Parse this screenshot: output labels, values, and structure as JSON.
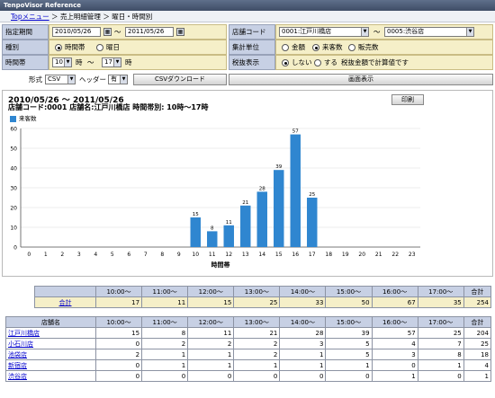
{
  "app": {
    "title": "TenpoVisor Reference"
  },
  "breadcrumb": {
    "top": "Topメニュー",
    "sep": " ＞ ",
    "level1": "売上明細管理",
    "level2": "曜日・時間別"
  },
  "form": {
    "period_label": "指定期間",
    "date_from": "2010/05/26",
    "range_sep": "〜",
    "date_to": "2011/05/26",
    "shop_label": "店舗コード",
    "shop_from": "0001:江戸川橋店",
    "shop_to": "0005:渋谷店",
    "type_label": "種別",
    "type_opt1": "時間帯",
    "type_opt2": "曜日",
    "unit_label": "集計単位",
    "unit_opt1": "金額",
    "unit_opt2": "来客数",
    "unit_opt3": "販売数",
    "hour_label": "時間帯",
    "hour_from": "10",
    "hour_unit": "時",
    "hour_to": "17",
    "tax_label": "税抜表示",
    "tax_opt1": "しない",
    "tax_opt2": "する",
    "tax_note": "税抜金額で計算値です",
    "format_label": "形式",
    "format_value": "CSV",
    "header_label": "ヘッダー",
    "header_value": "有",
    "csv_button": "CSVダウンロード",
    "display_button": "画面表示"
  },
  "chart": {
    "range_title": "2010/05/26 〜 2011/05/26",
    "shop_title": "店舗コード:0001  店舗名:江戸川橋店  時間帯別: 10時〜17時",
    "print_button": "印刷",
    "legend": "来客数",
    "xlabel": "時間帯"
  },
  "chart_data": {
    "type": "bar",
    "categories": [
      "0",
      "1",
      "2",
      "3",
      "4",
      "5",
      "6",
      "7",
      "8",
      "9",
      "10",
      "11",
      "12",
      "13",
      "14",
      "15",
      "16",
      "17",
      "18",
      "19",
      "20",
      "21",
      "22",
      "23"
    ],
    "series": [
      {
        "name": "来客数",
        "values": [
          0,
          0,
          0,
          0,
          0,
          0,
          0,
          0,
          0,
          0,
          15,
          8,
          11,
          21,
          28,
          39,
          57,
          25,
          0,
          0,
          0,
          0,
          0,
          0
        ]
      }
    ],
    "xlabel": "時間帯",
    "ylabel": "",
    "ylim": [
      0,
      60
    ],
    "yticks": [
      0,
      10,
      20,
      30,
      40,
      50,
      60
    ],
    "grid": true,
    "legend_position": "top-left",
    "color": "#2f86d0"
  },
  "summary_table": {
    "headers": [
      "",
      "10:00〜",
      "11:00〜",
      "12:00〜",
      "13:00〜",
      "14:00〜",
      "15:00〜",
      "16:00〜",
      "17:00〜",
      "合計"
    ],
    "row_label": "合計",
    "values": [
      "17",
      "11",
      "15",
      "25",
      "33",
      "50",
      "67",
      "35",
      "254"
    ]
  },
  "detail_table": {
    "headers": [
      "店舗名",
      "10:00〜",
      "11:00〜",
      "12:00〜",
      "13:00〜",
      "14:00〜",
      "15:00〜",
      "16:00〜",
      "17:00〜",
      "合計"
    ],
    "rows": [
      {
        "name": "江戸川橋店",
        "values": [
          "15",
          "8",
          "11",
          "21",
          "28",
          "39",
          "57",
          "25",
          "204"
        ]
      },
      {
        "name": "小石川店",
        "values": [
          "0",
          "2",
          "2",
          "2",
          "3",
          "5",
          "4",
          "7",
          "25"
        ]
      },
      {
        "name": "池袋店",
        "values": [
          "2",
          "1",
          "1",
          "2",
          "1",
          "5",
          "3",
          "8",
          "18"
        ]
      },
      {
        "name": "新宿店",
        "values": [
          "0",
          "1",
          "1",
          "1",
          "1",
          "1",
          "0",
          "1",
          "4"
        ]
      },
      {
        "name": "渋谷店",
        "values": [
          "0",
          "0",
          "0",
          "0",
          "0",
          "0",
          "1",
          "0",
          "1"
        ]
      }
    ]
  }
}
